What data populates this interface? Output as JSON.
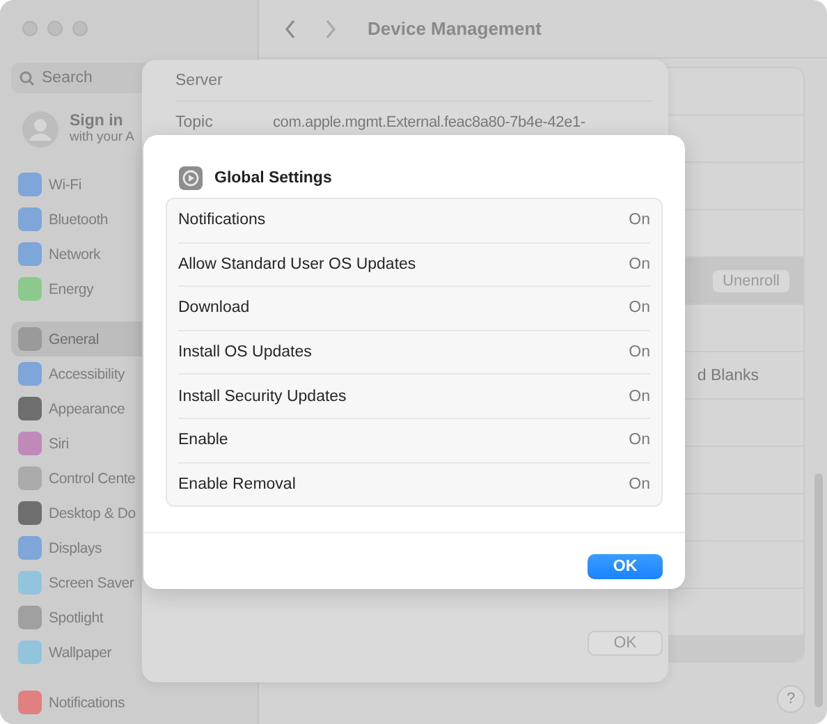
{
  "window": {
    "title": "Device Management"
  },
  "sidebar": {
    "search": {
      "placeholder": "Search"
    },
    "account": {
      "title": "Sign in",
      "subtitle": "with your A"
    },
    "groups": [
      [
        {
          "label": "Wi-Fi",
          "color": "#7fa6d8",
          "selected": false
        },
        {
          "label": "Bluetooth",
          "color": "#7fa6d8",
          "selected": false
        },
        {
          "label": "Network",
          "color": "#7fa6d8",
          "selected": false
        },
        {
          "label": "Energy",
          "color": "#8cc98c",
          "selected": false
        }
      ],
      [
        {
          "label": "General",
          "color": "#9a9a9a",
          "selected": true
        },
        {
          "label": "Accessibility",
          "color": "#7fa6d8",
          "selected": false
        },
        {
          "label": "Appearance",
          "color": "#6e6e6e",
          "selected": false
        },
        {
          "label": "Siri",
          "color": "#c08ab8",
          "selected": false
        },
        {
          "label": "Control Cente",
          "color": "#ababab",
          "selected": false
        },
        {
          "label": "Desktop & Do",
          "color": "#6e6e6e",
          "selected": false
        },
        {
          "label": "Displays",
          "color": "#7fa6d8",
          "selected": false
        },
        {
          "label": "Screen Saver",
          "color": "#92c4dc",
          "selected": false
        },
        {
          "label": "Spotlight",
          "color": "#a0a0a0",
          "selected": false
        },
        {
          "label": "Wallpaper",
          "color": "#92c4dc",
          "selected": false
        }
      ],
      [
        {
          "label": "Notifications",
          "color": "#e08080",
          "selected": false
        }
      ]
    ]
  },
  "content": {
    "unenroll_button": "Unenroll",
    "partial_text": "d Blanks",
    "help_button": "?"
  },
  "sheet": {
    "rows": [
      {
        "label": "Server"
      },
      {
        "label": "Topic",
        "value": "com.apple.mgmt.External.feac8a80-7b4e-42e1-"
      }
    ],
    "ok_button": "OK"
  },
  "dialog": {
    "title": "Global Settings",
    "rows": [
      {
        "label": "Notifications",
        "value": "On"
      },
      {
        "label": "Allow Standard User OS Updates",
        "value": "On"
      },
      {
        "label": "Download",
        "value": "On"
      },
      {
        "label": "Install OS Updates",
        "value": "On"
      },
      {
        "label": "Install Security Updates",
        "value": "On"
      },
      {
        "label": "Enable",
        "value": "On"
      },
      {
        "label": "Enable Removal",
        "value": "On"
      }
    ],
    "ok_button": "OK"
  }
}
